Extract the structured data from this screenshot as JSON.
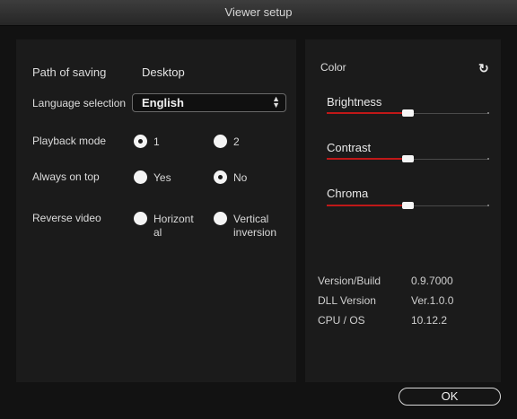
{
  "window": {
    "title": "Viewer setup"
  },
  "settings": {
    "path_label": "Path of saving",
    "path_value": "Desktop",
    "language_label": "Language selection",
    "language_value": "English",
    "playback_label": "Playback mode",
    "playback_options": [
      "1",
      "2"
    ],
    "playback_selected": "1",
    "ontop_label": "Always on top",
    "ontop_options": [
      "Yes",
      "No"
    ],
    "ontop_selected": "No",
    "reverse_label": "Reverse video",
    "reverse_options": [
      "Horizont al",
      "Vertical inversion"
    ],
    "reverse_option1_line1": "Horizont",
    "reverse_option1_line2": "al",
    "reverse_option2_line1": "Vertical",
    "reverse_option2_line2": "inversion"
  },
  "color": {
    "title": "Color",
    "refresh_icon": "refresh-icon",
    "sliders": [
      {
        "label": "Brightness",
        "level": 0.5
      },
      {
        "label": "Contrast",
        "level": 0.5
      },
      {
        "label": "Chroma",
        "level": 0.5
      }
    ],
    "slider_fill_color": "#c01818"
  },
  "info": {
    "version_label": "Version/Build",
    "version_value": "0.9.7000",
    "dll_label": "DLL Version",
    "dll_value": "Ver.1.0.0",
    "os_label": "CPU / OS",
    "os_value": "10.12.2"
  },
  "actions": {
    "ok_label": "OK"
  }
}
